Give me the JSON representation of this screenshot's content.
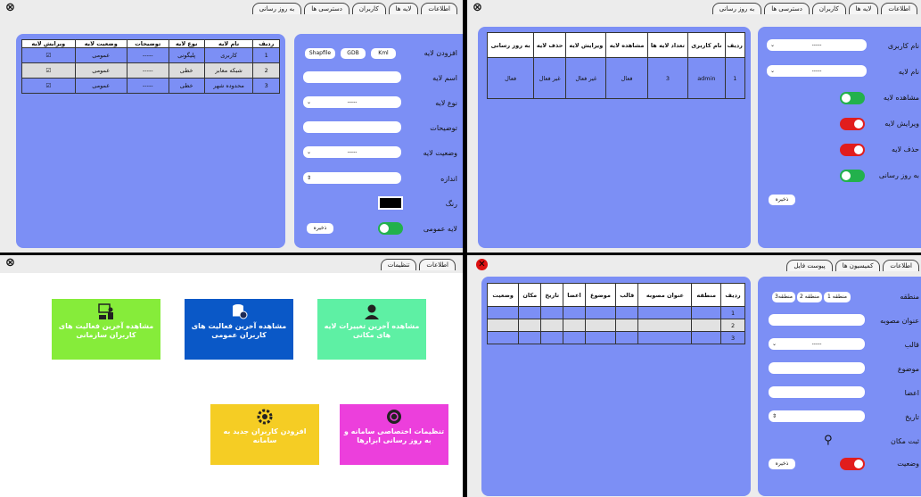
{
  "p1": {
    "tabs": [
      "اطلاعات",
      "لایه ها",
      "کاربران",
      "دسترسی ها",
      "به روز رسانی"
    ],
    "columns": [
      "ردیف",
      "نام لایه",
      "نوع لایه",
      "توضیحات",
      "وضعیت لایه",
      "ویرایش لایه"
    ],
    "rows": [
      [
        "1",
        "کاربری",
        "پلیگونی",
        "-----",
        "عمومی"
      ],
      [
        "2",
        "شبکه معابر",
        "خطی",
        "-----",
        "عمومی"
      ],
      [
        "3",
        "محدوده شهر",
        "خطی",
        "-----",
        "عمومی"
      ]
    ],
    "labels": [
      "افزودن لایه",
      "اسم لایه",
      "نوع لایه",
      "توضیحات",
      "وضعیت لایه",
      "اندازه",
      "رنگ",
      "لایه عمومی"
    ],
    "file_buttons": [
      "Shapfile",
      "GDB",
      "Kml"
    ],
    "dash": "-----",
    "save": "ذخیره"
  },
  "p2": {
    "tabs": [
      "اطلاعات",
      "لایه ها",
      "کاربران",
      "دسترسی ها",
      "به روز رسانی"
    ],
    "columns": [
      "ردیف",
      "نام کاربری",
      "تعداد لایه ها",
      "مشاهده لایه",
      "ویرایش لایه",
      "حذف لایه",
      "به روز رسانی"
    ],
    "row": [
      "1",
      "admin",
      "3",
      "فعال",
      "غیر فعال",
      "غیر فعال",
      "فعال"
    ],
    "labels": [
      "نام کاربری",
      "نام لایه",
      "مشاهده لایه",
      "ویرایش لایه",
      "حذف لایه",
      "به روز رسانی"
    ],
    "dash": "-----",
    "save": "ذخیره"
  },
  "p3": {
    "tabs": [
      "اطلاعات",
      "تنظیمات"
    ],
    "cards": [
      {
        "text": "مشاهده آخرین تغییرات لایه های مکانی",
        "color": "#5ef0a4"
      },
      {
        "text": "مشاهده آخرین فعالیت های کاربران عمومی",
        "color": "#0a58c7"
      },
      {
        "text": "مشاهده آخرین فعالیت های کاربران سازمانی",
        "color": "#86ec3a"
      },
      {
        "text": "تنظیمات اختصاصی سامانه و به روز رسانی ابزارها",
        "color": "#ec3fdc"
      },
      {
        "text": "افزودن کاربران جدید به سامانه",
        "color": "#f5cd24"
      }
    ]
  },
  "p4": {
    "tabs": [
      "اطلاعات",
      "کمیسیون ها",
      "پیوست فایل"
    ],
    "columns": [
      "ردیف",
      "منطقه",
      "عنوان مصوبه",
      "قالب",
      "موضوع",
      "اعضا",
      "تاریخ",
      "مکان",
      "وضعیت"
    ],
    "rows": [
      "1",
      "2",
      "3"
    ],
    "regions": [
      "منطقه 1",
      "منطقه 2",
      "منطقه3"
    ],
    "labels": [
      "منطقه",
      "عنوان مصوبه",
      "قالب",
      "موضوع",
      "اعضا",
      "تاریخ",
      "ثبت مکان",
      "وضعیت"
    ],
    "dash": "-----",
    "save": "ذخیره"
  }
}
